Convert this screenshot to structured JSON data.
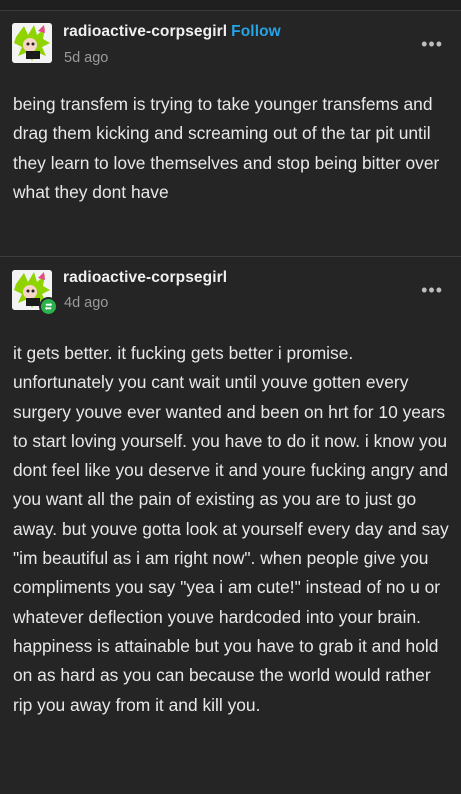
{
  "posts": [
    {
      "username": "radioactive-corpsegirl",
      "follow_label": "Follow",
      "timestamp": "5d ago",
      "more_label": "•••",
      "body": "being transfem is trying to take younger transfems and drag them kicking and screaming out of the tar pit until they learn to love themselves and stop being bitter over what they dont have"
    },
    {
      "username": "radioactive-corpsegirl",
      "timestamp": "4d ago",
      "more_label": "•••",
      "body": "it gets better. it fucking gets better i promise. unfortunately you cant wait until youve gotten every surgery youve ever wanted and been on hrt for 10 years to start loving yourself. you have to do it now. i know you dont feel like you deserve it and youre fucking angry and you want all the pain of existing as you are to just go away. but youve gotta look at yourself every day and say \"im beautiful as i am right now\". when people give you compliments you say \"yea i am cute!\" instead of no u or whatever deflection youve hardcoded into your brain. happiness is attainable but you have to grab it and hold on as hard as you can because the world would rather rip you away from it and kill you."
    }
  ],
  "colors": {
    "background": "#252525",
    "follow_accent": "#25a4e6",
    "reblog_badge": "#2bb24c",
    "text": "#e8e8e8",
    "muted": "#9a9a9a"
  }
}
